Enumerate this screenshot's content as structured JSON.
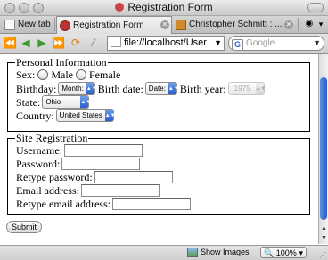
{
  "window": {
    "title": "Registration Form"
  },
  "tabs": [
    {
      "label": "New tab"
    },
    {
      "label": "Registration Form"
    },
    {
      "label": "Christopher Schmitt : ..."
    }
  ],
  "toolbar": {
    "url": "file://localhost/User",
    "search_placeholder": "Google"
  },
  "personal": {
    "legend": "Personal Information",
    "sex_label": "Sex:",
    "male_label": "Male",
    "female_label": "Female",
    "birthday_label": "Birthday:",
    "month_value": "Month:",
    "birthdate_label": "Birth date:",
    "date_value": "Date:",
    "birthyear_label": "Birth year:",
    "year_value": "1975",
    "state_label": "State:",
    "state_value": "Ohio",
    "country_label": "Country:",
    "country_value": "United States"
  },
  "site": {
    "legend": "Site Registration",
    "username_label": "Username:",
    "password_label": "Password:",
    "retype_password_label": "Retype password:",
    "email_label": "Email address:",
    "retype_email_label": "Retype email address:",
    "submit_label": "Submit"
  },
  "statusbar": {
    "show_images_label": "Show Images",
    "zoom_value": "100%"
  }
}
